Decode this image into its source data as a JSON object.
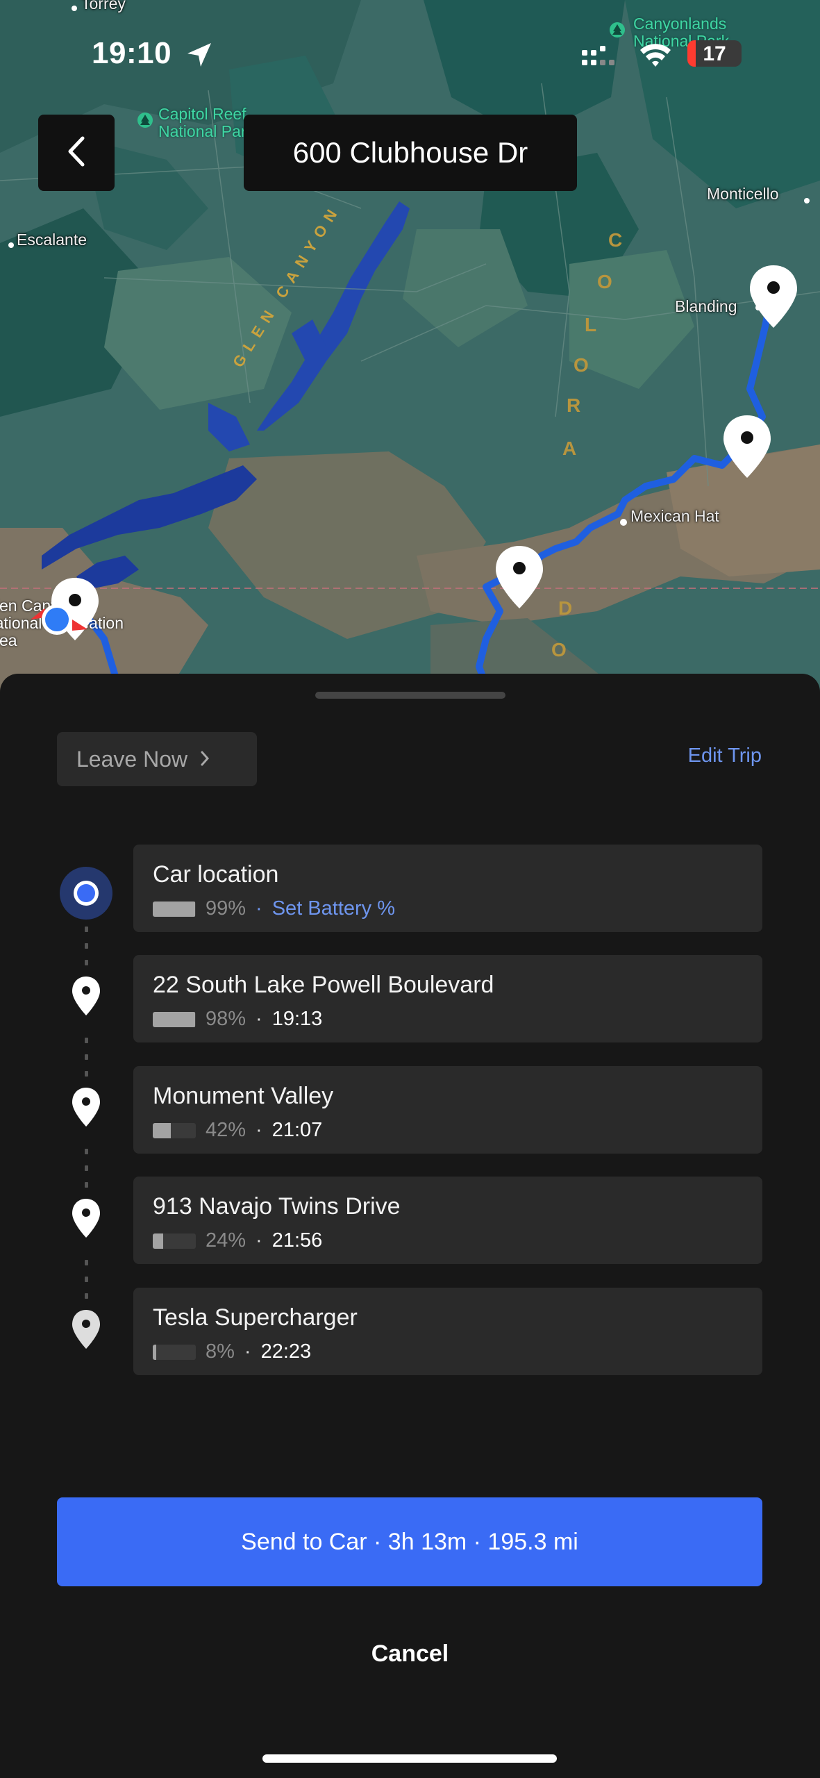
{
  "status_bar": {
    "time": "19:10",
    "battery": "17"
  },
  "header": {
    "title": "600 Clubhouse Dr"
  },
  "map": {
    "places": [
      "Torrey",
      "Escalante",
      "Monticello",
      "Blanding",
      "Mexican Hat"
    ],
    "parks": {
      "capitol_reef": [
        "Capitol Reef",
        "National Park"
      ],
      "canyonlands": [
        "Canyonlands",
        "National Park"
      ],
      "glen_canyon": [
        "Glen Canyon",
        "National Recreation",
        "Area"
      ]
    },
    "river_glen": "GLEN CANYON",
    "river_colorado": [
      "C",
      "O",
      "L",
      "O",
      "R",
      "A",
      "D",
      "O"
    ]
  },
  "trip": {
    "leave_now": "Leave Now",
    "edit_trip": "Edit Trip",
    "stops": [
      {
        "name": "Car location",
        "battery_pct": "99%",
        "battery_level": 0.99,
        "extra": "Set Battery %"
      },
      {
        "name": "22 South Lake Powell Boulevard",
        "battery_pct": "98%",
        "battery_level": 0.98,
        "arrival": "19:13"
      },
      {
        "name": "Monument Valley",
        "battery_pct": "42%",
        "battery_level": 0.42,
        "arrival": "21:07"
      },
      {
        "name": "913 Navajo Twins Drive",
        "battery_pct": "24%",
        "battery_level": 0.24,
        "arrival": "21:56"
      },
      {
        "name": "Tesla Supercharger",
        "battery_pct": "8%",
        "battery_level": 0.08,
        "arrival": "22:23"
      }
    ],
    "separator": "·"
  },
  "actions": {
    "send_to_car": "Send to Car · 3h 13m · 195.3 mi",
    "cancel": "Cancel"
  },
  "colors": {
    "accent": "#3a6bf5",
    "link": "#6e95ee",
    "route": "#1f5fe0"
  }
}
